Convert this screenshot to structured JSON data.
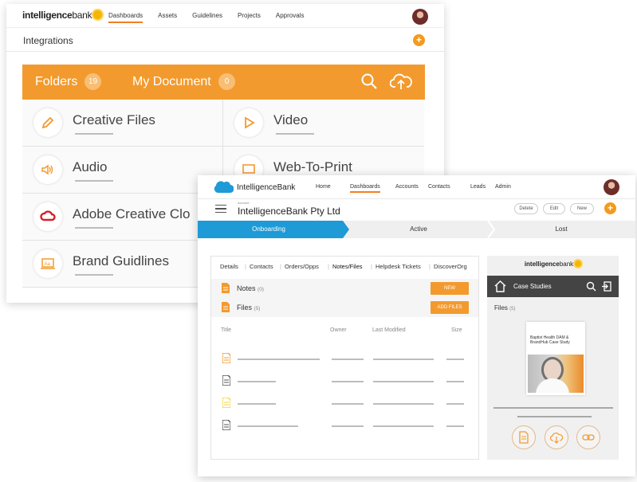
{
  "back_window": {
    "logo": {
      "bold": "intelligence",
      "light": "bank"
    },
    "nav": [
      {
        "label": "Dashboards",
        "active": true
      },
      {
        "label": "Assets",
        "active": false
      },
      {
        "label": "Guidelines",
        "active": false
      },
      {
        "label": "Projects",
        "active": false
      },
      {
        "label": "Approvals",
        "active": false
      }
    ],
    "page_title": "Integrations",
    "plus": "+",
    "bar": {
      "folders_label": "Folders",
      "folders_count": "19",
      "docs_label": "My Document",
      "docs_count": "0",
      "search_icon": "search-icon",
      "upload_icon": "cloud-upload-icon"
    },
    "folders": [
      {
        "label": "Creative Files",
        "icon": "pencil-icon"
      },
      {
        "label": "Video",
        "icon": "play-icon"
      },
      {
        "label": "Audio",
        "icon": "speaker-icon"
      },
      {
        "label": "Web-To-Print",
        "icon": "monitor-icon"
      },
      {
        "label": "Adobe Creative Clo",
        "icon": "adobe-cc-icon"
      },
      {
        "label": "Brand Guidlines",
        "icon": "brand-guide-icon"
      }
    ]
  },
  "front_window": {
    "brand": "IntelligenceBank",
    "nav": [
      {
        "label": "Home",
        "active": false
      },
      {
        "label": "Dashboards",
        "active": true
      },
      {
        "label": "Accounts",
        "active": false
      },
      {
        "label": "Contacts",
        "active": false
      },
      {
        "label": "Leads",
        "active": false
      },
      {
        "label": "Admin",
        "active": false
      }
    ],
    "account_small": "Account",
    "account_name": "IntelligenceBank Pty Ltd",
    "actions": {
      "delete": "Delete",
      "edit": "Edit",
      "new": "New",
      "plus": "+"
    },
    "stages": [
      {
        "label": "Onboarding",
        "active": true
      },
      {
        "label": "Active",
        "active": false
      },
      {
        "label": "Lost",
        "active": false
      }
    ],
    "tabs": [
      "Details",
      "Contacts",
      "Orders/Opps",
      "Notes/Files",
      "Helpdesk Tickets",
      "DiscoverOrg"
    ],
    "active_tab": "Notes/Files",
    "notes": {
      "label": "Notes",
      "count": "(0)",
      "button": "NEW"
    },
    "files": {
      "label": "Files",
      "count": "(5)",
      "button": "ADD FILES"
    },
    "table_headers": {
      "title": "Title",
      "owner": "Owner",
      "modified": "Last Modified",
      "size": "Size"
    },
    "file_icon_colors": [
      "#f39a2e",
      "#555555",
      "#f5d33a",
      "#555555"
    ],
    "panel": {
      "logo": {
        "bold": "intelligence",
        "light": "bank"
      },
      "title": "Case Studies",
      "files_label": "Files",
      "files_count": "(5)",
      "doc_title": "Baptist Health DAM & BrandHub Case Study"
    }
  },
  "colors": {
    "accent": "#f39a2e",
    "salesforce_blue": "#1e9ad6",
    "dark_bar": "#444444"
  }
}
